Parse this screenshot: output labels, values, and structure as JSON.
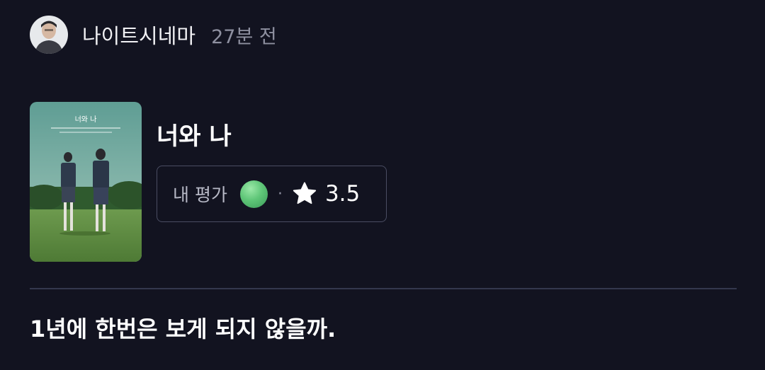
{
  "post": {
    "username": "나이트시네마",
    "timestamp": "27분 전",
    "avatar_icon": "user-avatar-photo"
  },
  "movie": {
    "title": "너와 나",
    "poster_title": "너와 나",
    "poster_icon": "movie-poster-image"
  },
  "rating": {
    "label": "내 평가",
    "reaction_color": "#5fc678",
    "separator": "·",
    "star_icon": "star-icon",
    "value": "3.5"
  },
  "review": {
    "text": "1년에 한번은 보게 되지 않을까."
  },
  "colors": {
    "background": "#121320",
    "border": "#4a4d63",
    "divider": "#34374d",
    "muted_text": "#8e90a0"
  }
}
